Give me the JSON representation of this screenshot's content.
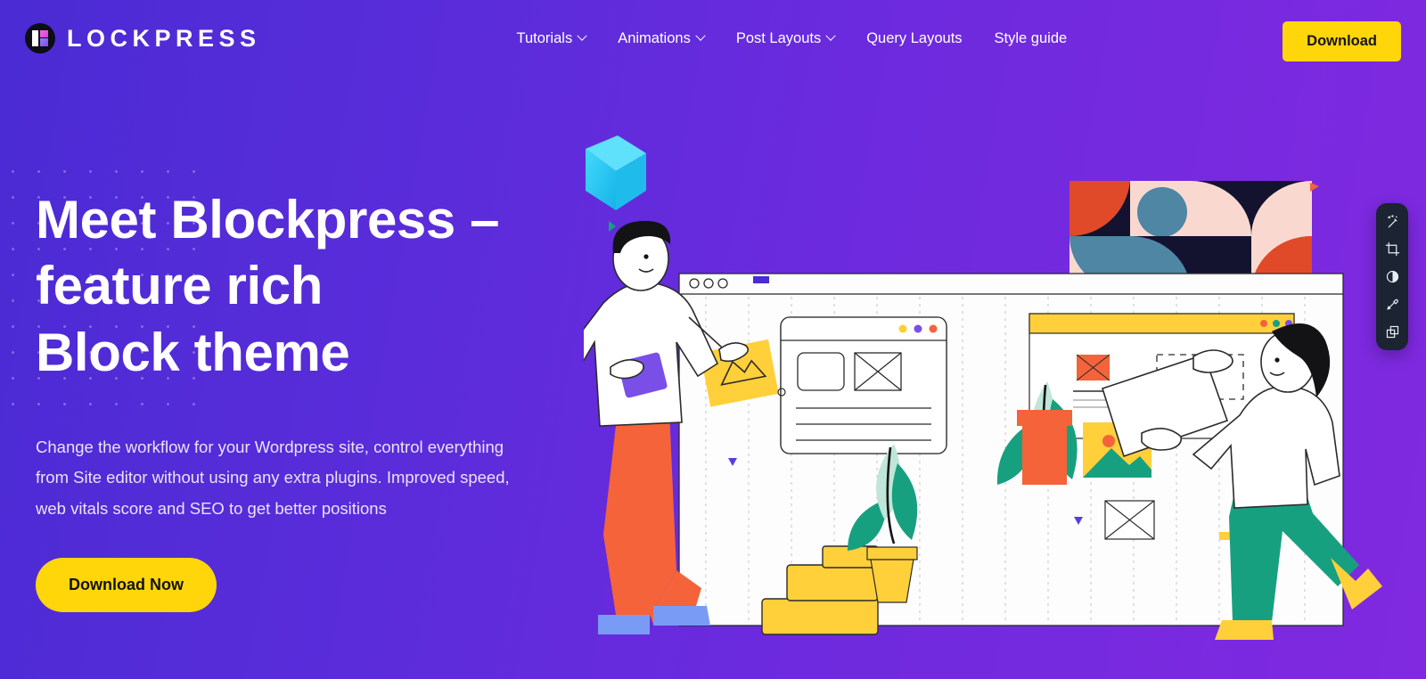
{
  "brand": {
    "name": "LOCKPRESS",
    "logo_icon": "blockpress-logo-icon"
  },
  "nav": {
    "items": [
      {
        "label": "Tutorials",
        "has_dropdown": true
      },
      {
        "label": "Animations",
        "has_dropdown": true
      },
      {
        "label": "Post Layouts",
        "has_dropdown": true
      },
      {
        "label": "Query Layouts",
        "has_dropdown": false
      },
      {
        "label": "Style guide",
        "has_dropdown": false
      }
    ]
  },
  "header": {
    "download_label": "Download"
  },
  "hero": {
    "headline": "Meet Blockpress –\nfeature rich\nBlock theme",
    "subcopy": "Change the workflow for your Wordpress site, control everything from Site editor without using any extra plugins. Improved speed, web vitals score and SEO to get better positions",
    "cta_label": "Download Now"
  },
  "dock": {
    "tools": [
      {
        "name": "magic-wand-icon"
      },
      {
        "name": "crop-icon"
      },
      {
        "name": "contrast-icon"
      },
      {
        "name": "brush-icon"
      },
      {
        "name": "layers-icon"
      }
    ]
  },
  "colors": {
    "bg_gradient_start": "#4a2bd4",
    "bg_gradient_end": "#8029e0",
    "accent_yellow": "#ffd60a",
    "text_light": "#eae3fb",
    "dock_bg": "#1c2333",
    "illustration_orange": "#f4633a",
    "illustration_teal": "#17a07f",
    "illustration_navy": "#131330",
    "illustration_pink": "#f9d9cf",
    "illustration_blue": "#4e86a4",
    "illustration_cube": "#2fc7f0"
  }
}
